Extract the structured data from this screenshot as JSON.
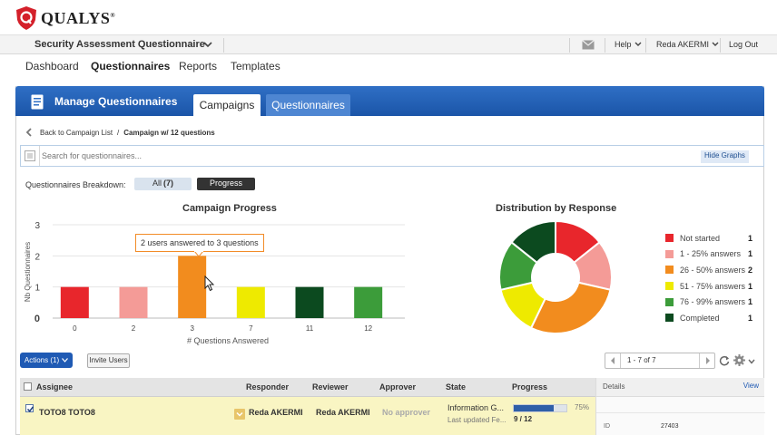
{
  "brand": {
    "name": "QUALYS",
    "trademark": "®"
  },
  "module_bar": {
    "module": "Security Assessment Questionnaire",
    "help": "Help",
    "user": "Reda AKERMI",
    "logout": "Log Out"
  },
  "nav": [
    "Dashboard",
    "Questionnaires",
    "Reports",
    "Templates"
  ],
  "panel": {
    "title": "Manage Questionnaires",
    "tabs": [
      "Campaigns",
      "Questionnaires"
    ]
  },
  "breadcrumb": {
    "back": "Back to Campaign List",
    "separator": "/",
    "current": "Campaign w/ 12 questions"
  },
  "search": {
    "placeholder": "Search for questionnaires...",
    "hide_graphs": "Hide Graphs"
  },
  "breakdown": {
    "label": "Questionnaires Breakdown:",
    "all": "All",
    "all_count": "(7)",
    "progress": "Progress"
  },
  "chart_data": [
    {
      "type": "bar",
      "title": "Campaign Progress",
      "xlabel": "# Questions Answered",
      "ylabel": "Nb Questionnaires",
      "categories": [
        "0",
        "2",
        "3",
        "7",
        "11",
        "12"
      ],
      "values": [
        1,
        1,
        2,
        1,
        1,
        1
      ],
      "colors": [
        "#e8262c",
        "#f49b97",
        "#f28c1e",
        "#eeea00",
        "#0c4a1f",
        "#3c9c3a"
      ],
      "ylim": [
        0,
        3
      ],
      "yticks": [
        "0",
        "1",
        "2",
        "3"
      ],
      "grid": true,
      "tooltip": "2 users answered to 3 questions"
    },
    {
      "type": "pie",
      "title": "Distribution by Response",
      "legend_position": "right",
      "series": [
        {
          "name": "Not started",
          "value": 1,
          "color": "#e8262c"
        },
        {
          "name": "1 - 25% answers",
          "value": 1,
          "color": "#f49b97"
        },
        {
          "name": "26 - 50% answers",
          "value": 2,
          "color": "#f28c1e"
        },
        {
          "name": "51 - 75% answers",
          "value": 1,
          "color": "#eeea00"
        },
        {
          "name": "76 - 99% answers",
          "value": 1,
          "color": "#3c9c3a"
        },
        {
          "name": "Completed",
          "value": 1,
          "color": "#0c4a1f"
        }
      ]
    }
  ],
  "toolbar": {
    "actions": "Actions (1)",
    "invite": "Invite Users",
    "pager": "1 - 7 of 7"
  },
  "table": {
    "headers": [
      "Assignee",
      "Responder",
      "Reviewer",
      "Approver",
      "State",
      "Progress"
    ],
    "rows": [
      {
        "assignee": "TOTO8 TOTO8",
        "responder": "Reda AKERMI",
        "reviewer": "Reda AKERMI",
        "approver": "No approver",
        "state": "Information G...",
        "state_sub": "Last updated Fe...",
        "progress_pct": "75%",
        "progress_fraction": 0.75,
        "progress_count": "9 / 12"
      }
    ]
  },
  "details": {
    "label": "Details",
    "view": "View",
    "id_label": "ID",
    "id_value": "27403"
  },
  "colors": {
    "accent": "#1f5ab4",
    "header_blue": "#2f6fc5",
    "selected_row": "#f9f5c3"
  }
}
